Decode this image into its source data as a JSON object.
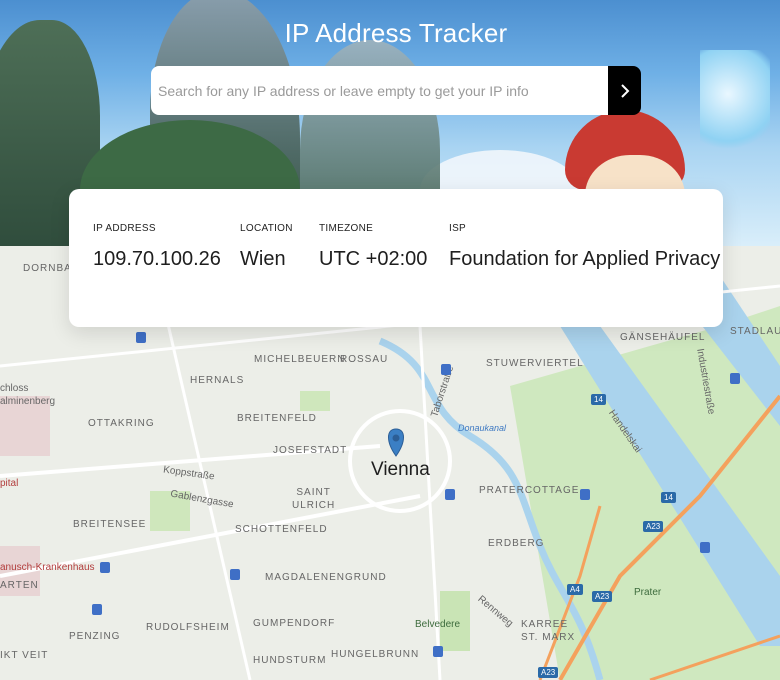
{
  "header": {
    "title": "IP Address Tracker",
    "search": {
      "placeholder": "Search for any IP address or leave empty to get your IP info",
      "value": "",
      "button_icon": "chevron-right-icon"
    }
  },
  "info": {
    "ip_address": {
      "label": "IP ADDRESS",
      "value": "109.70.100.26"
    },
    "location": {
      "label": "LOCATION",
      "value": "Wien"
    },
    "timezone": {
      "label": "TIMEZONE",
      "value": "UTC +02:00"
    },
    "isp": {
      "label": "ISP",
      "value": "Foundation for Applied Privacy"
    }
  },
  "map": {
    "city": "Vienna",
    "marker_icon": "map-pin-icon",
    "districts": {
      "dornbach": "DORNBACH",
      "michelbeuern": "MICHELBEUERN",
      "rossau": "ROSSAU",
      "stuwerviertel": "STUWERVIERTEL",
      "gansehaufel": "GÄNSEHÄUFEL",
      "stadlau": "STADLAU",
      "hernals": "HERNALS",
      "breitenfeld": "BREITENFELD",
      "ottakring": "OTTAKRING",
      "josefstadt": "JOSEFSTADT",
      "saint_ulrich": "SAINT\nULRICH",
      "pratercottage": "PRATERCOTTAGE",
      "breitensee": "BREITENSEE",
      "schottenfeld": "SCHOTTENFELD",
      "erdberg": "ERDBERG",
      "magdalenengrund": "MAGDALENENGRUND",
      "penzing": "PENZING",
      "rudolfsheim": "RUDOLFSHEIM",
      "gumpendorf": "GUMPENDORF",
      "karree_st_marx": "KARREE\nST. MARX",
      "hundsturm": "HUNDSTURM",
      "hungelbrunn": "HUNGELBRUNN",
      "prater": "Prater",
      "belvedere": "Belvedere",
      "kt_veit": "IKT VEIT",
      "arten": "ARTEN",
      "schloss": "chloss\nalminenberg",
      "spital": "pital",
      "krankenhaus": "anusch-Krankenhaus"
    },
    "streets": {
      "taborstrasse": "Taborstraße",
      "industriestrasse": "Industriestraße",
      "handelskai": "Handelskai",
      "kopp": "Koppstraße",
      "gablenz": "Gablenzgasse",
      "rennweg": "Rennweg",
      "donaukanal": "Donaukanal"
    },
    "road_shields": {
      "a14_1": "14",
      "a14_2": "14",
      "a23_1": "A23",
      "a23_2": "A23",
      "a23_3": "A23",
      "a4": "A4"
    }
  },
  "colors": {
    "button": "#000000",
    "marker": "#3b7fc4",
    "water": "#aad3ed",
    "park": "#c9e4b5",
    "highway": "#f4a15d"
  }
}
